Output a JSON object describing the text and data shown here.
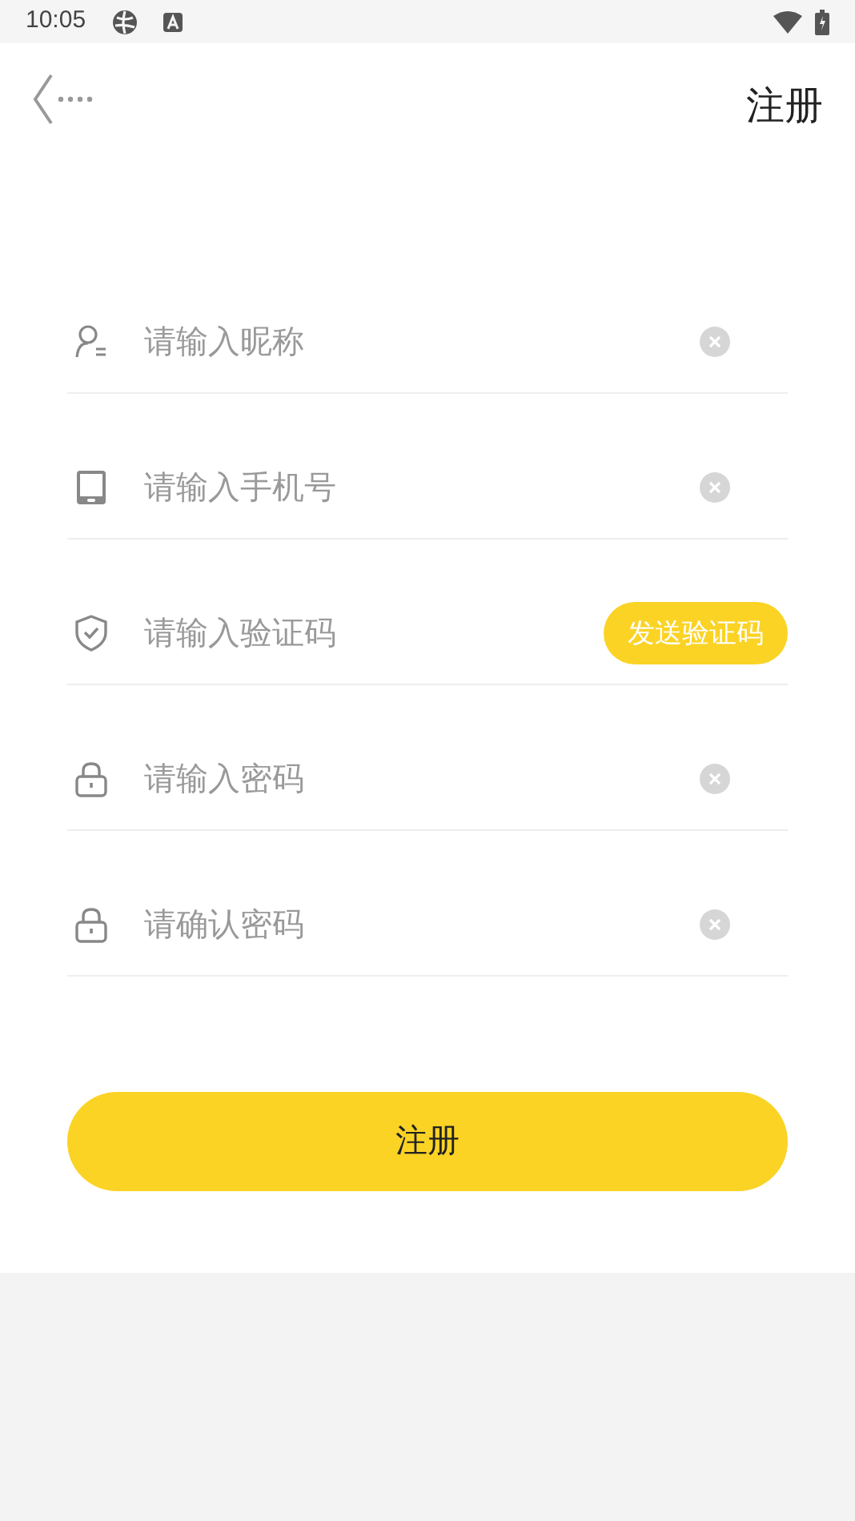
{
  "status_bar": {
    "time": "10:05"
  },
  "header": {
    "title": "注册"
  },
  "fields": [
    {
      "kind": "user",
      "placeholder": "请输入昵称",
      "clearable": true
    },
    {
      "kind": "phone",
      "placeholder": "请输入手机号",
      "clearable": true
    },
    {
      "kind": "code",
      "placeholder": "请输入验证码",
      "clearable": false,
      "button_label": "发送验证码"
    },
    {
      "kind": "password",
      "placeholder": "请输入密码",
      "clearable": true
    },
    {
      "kind": "password",
      "placeholder": "请确认密码",
      "clearable": true
    }
  ],
  "submit": {
    "label": "注册"
  }
}
